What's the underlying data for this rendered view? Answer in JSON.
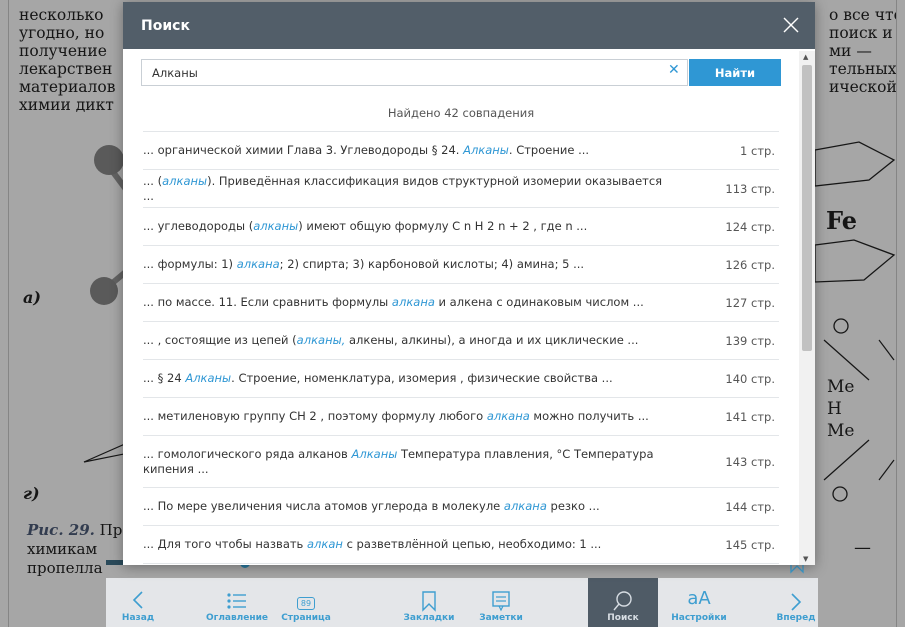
{
  "background": {
    "left_lines": [
      "несколько",
      "угодно, но",
      "получение",
      "лекарствен",
      "материалов",
      "химии дикт"
    ],
    "right_lines": [
      "о все что",
      "поиск и",
      "ми —",
      "тельных",
      "ической"
    ],
    "fig_label_a": "а)",
    "fig_label_g": "г)",
    "caption_ric": "Рис. 29.",
    "caption_ric_tail": "Пр",
    "caption_lines": [
      "химикам",
      "пропелла"
    ],
    "fe": "Fe",
    "me1": "Me",
    "h": "H",
    "me2": "Me",
    "dash": "—"
  },
  "toolbar": {
    "items": [
      {
        "label": "Назад",
        "icon": "chevron-left-icon"
      },
      {
        "label": "Оглавление",
        "icon": "list-icon"
      },
      {
        "label": "Страница",
        "icon": "page-icon",
        "page_number": "89"
      },
      {
        "label": "Закладки",
        "icon": "bookmark-icon"
      },
      {
        "label": "Заметки",
        "icon": "notes-icon"
      },
      {
        "label": "Поиск",
        "icon": "search-icon"
      },
      {
        "label": "Настройки",
        "icon": "font-settings-icon",
        "glyph": "aA"
      },
      {
        "label": "Вперед",
        "icon": "chevron-right-icon"
      }
    ],
    "active": "Поиск",
    "reading_progress": 0.2
  },
  "modal": {
    "title": "Поиск",
    "search_value": "Алканы",
    "find_button": "Найти",
    "count_text": "Найдено 42 совпадения",
    "results": [
      {
        "before": "... органической химии Глава 3. Углеводороды § 24. ",
        "hl": "Алканы",
        "after": ". Строение ...",
        "page": "1 стр."
      },
      {
        "before": "... (",
        "hl": "алканы",
        "after": "). Приведённая классификация видов структурной изомерии оказывается ...",
        "page": "113 стр."
      },
      {
        "before": "... углеводороды (",
        "hl": "алканы",
        "after": ") имеют общую формулу C n H 2 n  + 2 , где n ...",
        "page": "124 стр."
      },
      {
        "before": "... формулы: 1) ",
        "hl": "алкана",
        "after": "; 2) спирта; 3) карбоновой кислоты; 4) амина; 5 ...",
        "page": "126 стр."
      },
      {
        "before": "... по массе. 11. Если сравнить формулы ",
        "hl": "алкана",
        "after": " и алкена с одинаковым числом ...",
        "page": "127 стр."
      },
      {
        "before": "... , состоящие из цепей (",
        "hl": "алканы,",
        "after": " алкены, алкины), а иногда и их циклические ...",
        "page": "139 стр."
      },
      {
        "before": "... § 24 ",
        "hl": "Алканы",
        "after": ". Строение, номенклатура, изомерия , физические свойства ...",
        "page": "140 стр."
      },
      {
        "before": "... метиленовую группу CH 2 , поэтому формулу любого ",
        "hl": "алкана",
        "after": " можно получить ...",
        "page": "141 стр."
      },
      {
        "before": "... гомологического ряда алканов ",
        "hl": "Алканы",
        "after": " Температура плавления, °С Температура кипения ...",
        "page": "143 стр."
      },
      {
        "before": "... По мере увеличения числа атомов углерода в молекуле ",
        "hl": "алкана",
        "after": " резко ...",
        "page": "144 стр."
      },
      {
        "before": "... Для того чтобы назвать ",
        "hl": "алкан",
        "after": " с разветвлённой цепью, необходимо: 1 ...",
        "page": "145 стр."
      }
    ]
  },
  "colors": {
    "header": "#525e69",
    "accent": "#2f97d4",
    "toolbar_bg": "#e4e6e9",
    "toolbar_active": "#4f5b66"
  }
}
